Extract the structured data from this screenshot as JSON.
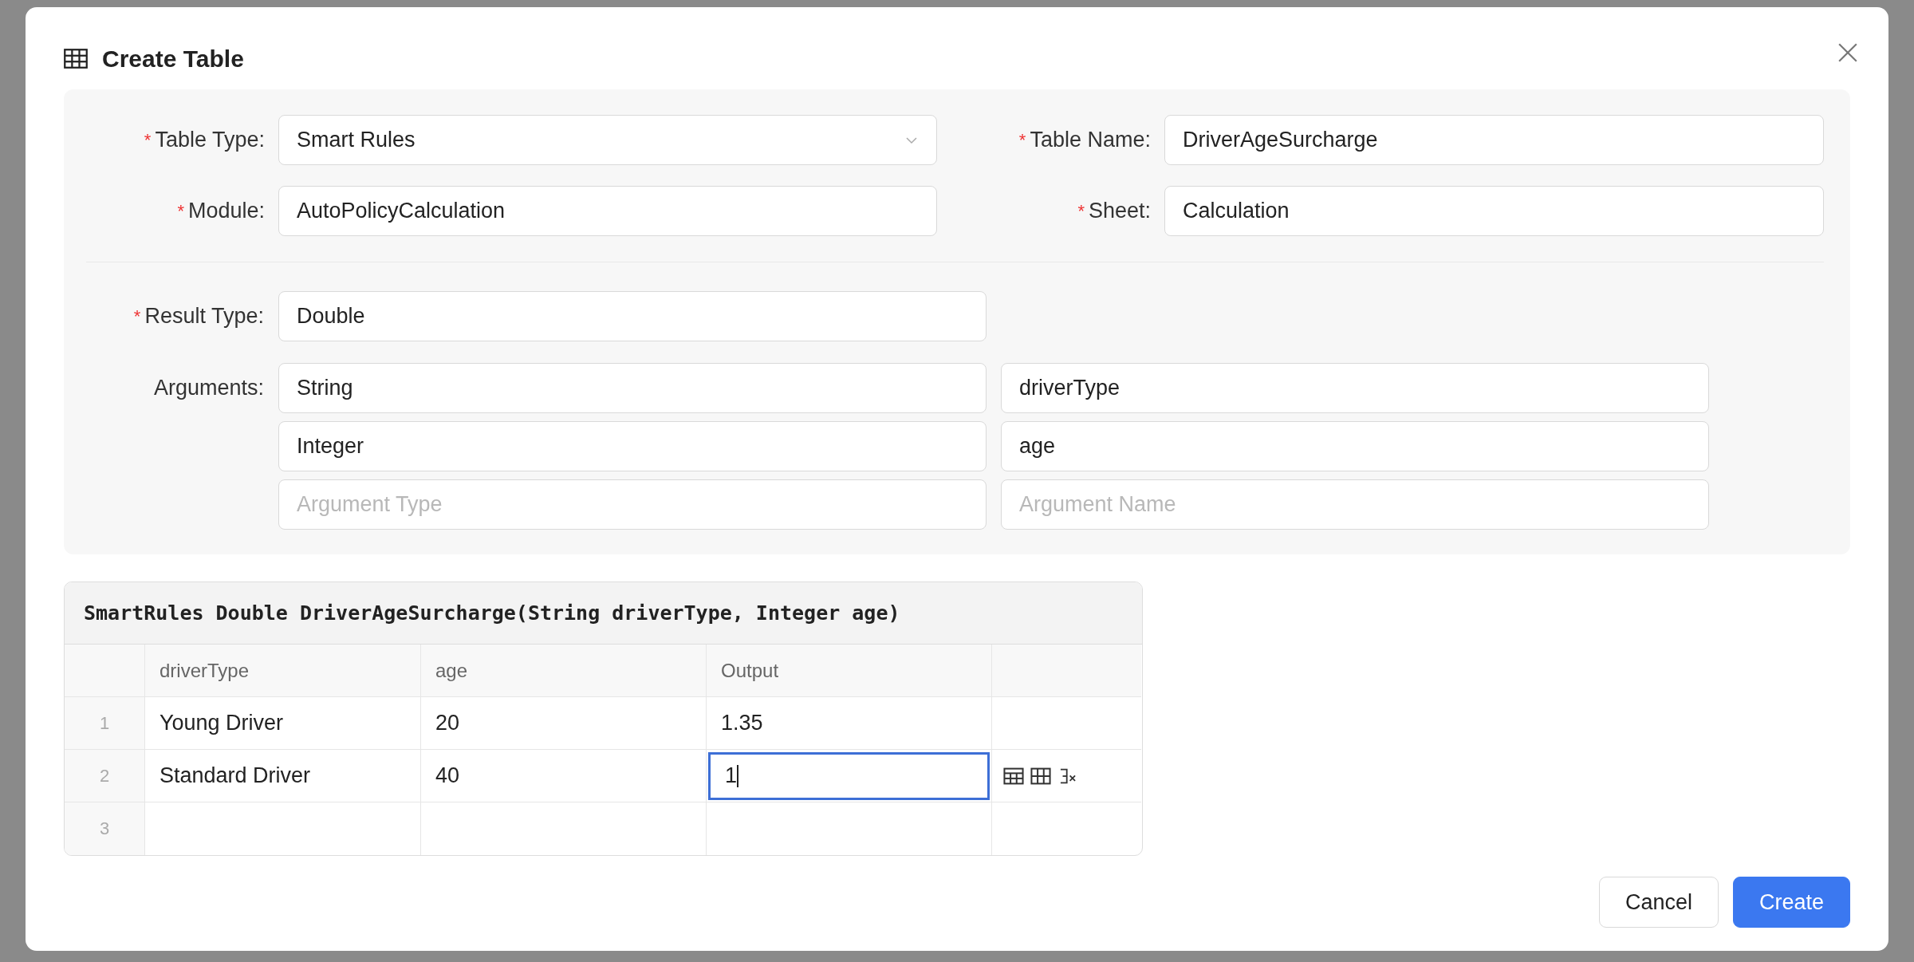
{
  "dialog": {
    "title": "Create Table"
  },
  "top_fields": [
    {
      "label": "Table Type:",
      "required_mark": "*",
      "kind": "select",
      "value": "Smart Rules"
    },
    {
      "label": "Table Name:",
      "required_mark": "*",
      "kind": "text",
      "value": "DriverAgeSurcharge"
    },
    {
      "label": "Module:",
      "required_mark": "*",
      "kind": "text",
      "value": "AutoPolicyCalculation"
    },
    {
      "label": "Sheet:",
      "required_mark": "*",
      "kind": "text",
      "value": "Calculation"
    }
  ],
  "result_type": {
    "label": "Result Type:",
    "required_mark": "*",
    "value": "Double"
  },
  "arguments": {
    "label": "Arguments:",
    "items": [
      {
        "type": {
          "value": "String"
        },
        "name": {
          "value": "driverType"
        }
      },
      {
        "type": {
          "value": "Integer"
        },
        "name": {
          "value": "age"
        }
      },
      {
        "type": {
          "placeholder": "Argument Type"
        },
        "name": {
          "placeholder": "Argument Name"
        }
      }
    ]
  },
  "table": {
    "signature": "SmartRules Double DriverAgeSurcharge(String driverType, Integer age)",
    "columns": [
      "driverType",
      "age",
      "Output"
    ],
    "rows": [
      {
        "number": "1",
        "active": false,
        "cells": [
          {
            "text": "Young Driver",
            "focused": false
          },
          {
            "text": "20",
            "focused": false
          },
          {
            "text": "1.35",
            "focused": false
          }
        ]
      },
      {
        "number": "2",
        "active": true,
        "cells": [
          {
            "text": "Standard Driver",
            "focused": false
          },
          {
            "text": "40",
            "focused": false
          },
          {
            "text": "1",
            "focused": true
          }
        ]
      },
      {
        "number": "3",
        "active": false
      }
    ]
  },
  "buttons": [
    {
      "label": "Cancel",
      "kind": "default"
    },
    {
      "label": "Create",
      "kind": "primary"
    }
  ]
}
